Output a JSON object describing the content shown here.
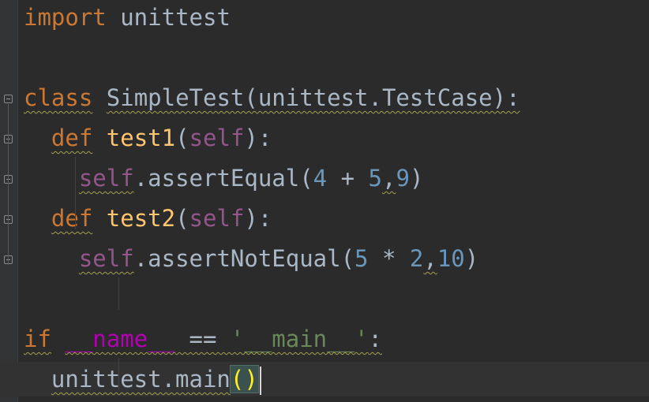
{
  "editor": {
    "lines": [
      {
        "segments": [
          {
            "t": "import",
            "c": "kw"
          },
          {
            "t": " unittest",
            "c": "ref"
          }
        ]
      },
      {
        "segments": []
      },
      {
        "segments": [
          {
            "t": "class",
            "c": "kw wavy"
          },
          {
            "t": " ",
            "c": "ref"
          },
          {
            "t": "SimpleTest(unittest.TestCase):",
            "c": "ref wavy"
          }
        ]
      },
      {
        "segments": [
          {
            "t": "  ",
            "c": "ref"
          },
          {
            "t": "def",
            "c": "kw wavy"
          },
          {
            "t": " ",
            "c": "ref"
          },
          {
            "t": "test1",
            "c": "fn"
          },
          {
            "t": "(",
            "c": "ref"
          },
          {
            "t": "self",
            "c": "slf"
          },
          {
            "t": "):",
            "c": "ref"
          }
        ]
      },
      {
        "segments": [
          {
            "t": "    ",
            "c": "ref"
          },
          {
            "t": "self",
            "c": "slf wavy"
          },
          {
            "t": ".assertEqual(",
            "c": "ref"
          },
          {
            "t": "4",
            "c": "num"
          },
          {
            "t": " + ",
            "c": "ref"
          },
          {
            "t": "5",
            "c": "num"
          },
          {
            "t": ",",
            "c": "ref wavy"
          },
          {
            "t": "9",
            "c": "num"
          },
          {
            "t": ")",
            "c": "ref"
          }
        ]
      },
      {
        "segments": [
          {
            "t": "  ",
            "c": "ref"
          },
          {
            "t": "def",
            "c": "kw wavy"
          },
          {
            "t": " ",
            "c": "ref"
          },
          {
            "t": "test2",
            "c": "fn"
          },
          {
            "t": "(",
            "c": "ref"
          },
          {
            "t": "self",
            "c": "slf"
          },
          {
            "t": "):",
            "c": "ref"
          }
        ]
      },
      {
        "segments": [
          {
            "t": "    ",
            "c": "ref"
          },
          {
            "t": "self",
            "c": "slf wavy"
          },
          {
            "t": ".assertNotEqual(",
            "c": "ref"
          },
          {
            "t": "5",
            "c": "num"
          },
          {
            "t": " * ",
            "c": "ref"
          },
          {
            "t": "2",
            "c": "num"
          },
          {
            "t": ",",
            "c": "ref wavy"
          },
          {
            "t": "10",
            "c": "num"
          },
          {
            "t": ")",
            "c": "ref"
          }
        ]
      },
      {
        "segments": []
      },
      {
        "segments": [
          {
            "t": "if",
            "c": "kw wavy"
          },
          {
            "t": " ",
            "c": "ref"
          },
          {
            "t": "__name__",
            "c": "dunder wavy"
          },
          {
            "t": " == ",
            "c": "ref wavy"
          },
          {
            "t": "'__main__'",
            "c": "str wavy"
          },
          {
            "t": ":",
            "c": "ref wavy"
          }
        ]
      },
      {
        "segments": [
          {
            "t": "  ",
            "c": "ref"
          },
          {
            "t": "unittest.main",
            "c": "ref wavy"
          },
          {
            "t": "()",
            "c": "paren-match"
          }
        ]
      }
    ]
  }
}
